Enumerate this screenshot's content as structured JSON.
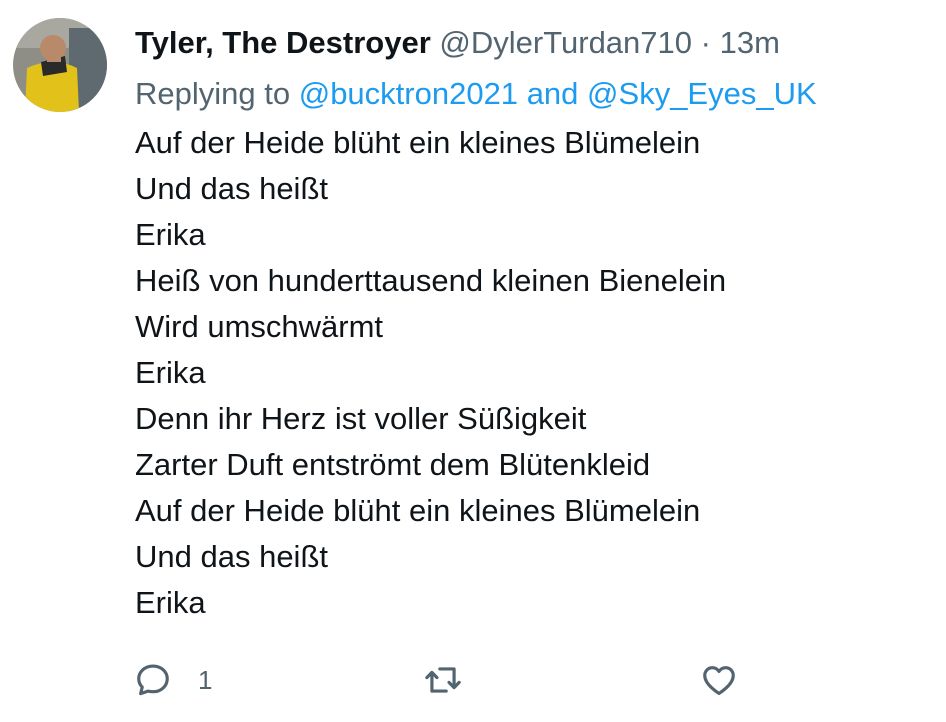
{
  "tweet": {
    "author_name": "Tyler, The Destroyer",
    "handle": "@DylerTurdan710",
    "separator": "·",
    "time": "13m",
    "replying_to_label": "Replying to",
    "reply_mentions": [
      "@bucktron2021",
      "@Sky_Eyes_UK"
    ],
    "reply_joiner": "and",
    "lines": [
      "Auf der Heide blüht ein kleines Blümelein",
      "Und das heißt",
      "Erika",
      "Heiß von hunderttausend kleinen Bienelein",
      "Wird umschwärmt",
      "Erika",
      "Denn ihr Herz ist voller Süßigkeit",
      "Zarter Duft entströmt dem Blütenkleid",
      "Auf der Heide blüht ein kleines Blümelein",
      "Und das heißt",
      "Erika"
    ],
    "actions": {
      "reply_count": "1",
      "reply_icon": "reply-icon",
      "retweet_icon": "retweet-icon",
      "like_icon": "heart-icon"
    }
  },
  "colors": {
    "text": "#0f1419",
    "secondary": "#536471",
    "accent": "#1d9bf0",
    "background": "#ffffff"
  }
}
